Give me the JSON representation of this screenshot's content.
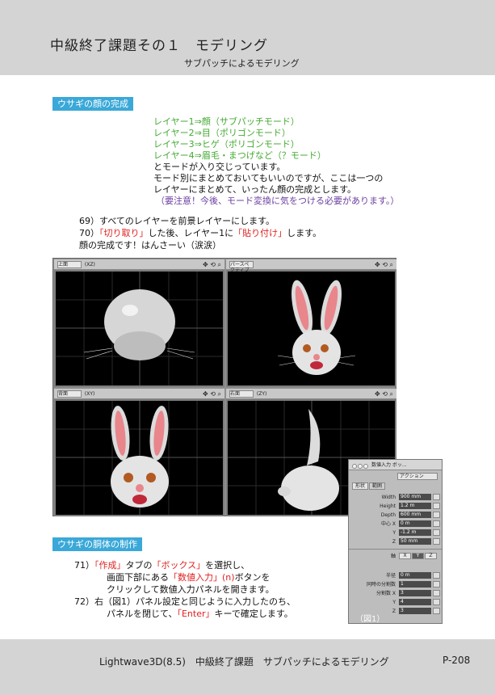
{
  "header": {
    "title": "中級終了課題その１　モデリング",
    "subtitle": "サブパッチによるモデリング"
  },
  "section1": {
    "tag": "ウサギの顔の完成",
    "layers": [
      "レイヤー1⇒顔（サブパッチモード）",
      "レイヤー2⇒目（ポリゴンモード）",
      "レイヤー3⇒ヒゲ（ポリゴンモード）",
      "レイヤー4⇒眉毛・まつげなど（？モード）"
    ],
    "notes": [
      "とモードが入り交じっています。",
      "モード別にまとめておいてもいいのですが、ここは一つの",
      "レイヤーにまとめて、いったん顔の完成とします。"
    ],
    "warning": "（要注意！今後、モード変換に気をつける必要があります。）",
    "step69": "69）すべてのレイヤーを前景レイヤーにします。",
    "step70_a": "70）",
    "step70_cut": "「切り取り」",
    "step70_b": "した後、レイヤー1に",
    "step70_paste": "「貼り付け」",
    "step70_c": "します。",
    "done": "顔の完成です！はんさーい（涙涙）"
  },
  "viewports": [
    {
      "label": "上面",
      "axis": "(XZ)"
    },
    {
      "label": "パースペクティブ",
      "axis": ""
    },
    {
      "label": "背面",
      "axis": "(XY)"
    },
    {
      "label": "右面",
      "axis": "(ZY)"
    }
  ],
  "panel": {
    "title": "数値入力 ボッ...",
    "mode": "アクション",
    "tabs": [
      "形状",
      "範囲"
    ],
    "rows": [
      {
        "label": "Width",
        "value": "900 mm"
      },
      {
        "label": "Height",
        "value": "1.2 m"
      },
      {
        "label": "Depth",
        "value": "600 mm"
      },
      {
        "label": "中心 X",
        "value": "0 m"
      },
      {
        "label": "Y",
        "value": "-1.2 m"
      },
      {
        "label": "Z",
        "value": "50 mm"
      }
    ],
    "axis_label": "軸",
    "axes": [
      "X",
      "Y",
      "Z"
    ],
    "rows2": [
      {
        "label": "半径",
        "value": "0 m"
      },
      {
        "label": "同時の分割数",
        "value": "1"
      },
      {
        "label": "分割数 X",
        "value": "3"
      },
      {
        "label": "Y",
        "value": "4"
      },
      {
        "label": "Z",
        "value": "3"
      }
    ],
    "figure": "（図1）"
  },
  "section2": {
    "tag": "ウサギの胴体の制作",
    "s71_a": "71）",
    "s71_tab": "「作成」",
    "s71_b": "タブの",
    "s71_box": "「ボックス」",
    "s71_c": "を選択し、",
    "s71_line2_a": "画面下部にある",
    "s71_numeric": "「数値入力」",
    "s71_n": "(n)",
    "s71_line2_b": "ボタンを",
    "s71_line3": "クリックして数値入力パネルを開きます。",
    "s72_line1": "72）右（図1）パネル設定と同じように入力したのち、",
    "s72_line2_a": "パネルを閉じて、",
    "s72_enter": "「Enter」",
    "s72_line2_b": "キーで確定します。"
  },
  "footer": {
    "text": "Lightwave3D(8.5)　中級終了課題　サブパッチによるモデリング",
    "page": "P-208"
  }
}
